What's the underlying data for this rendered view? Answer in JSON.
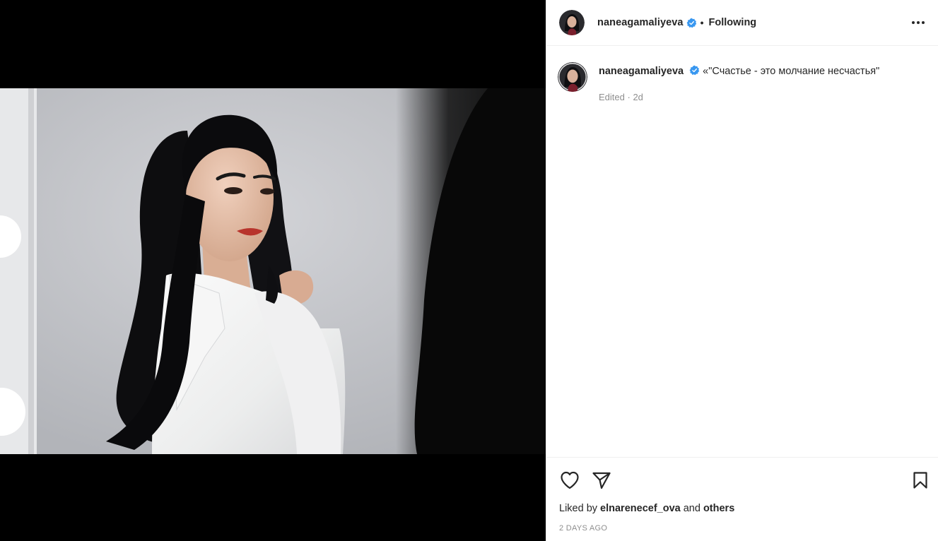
{
  "post": {
    "username": "naneagamaliyeva",
    "verified": true,
    "separator": "•",
    "follow_status": "Following",
    "more_icon": "more-horizontal-icon"
  },
  "caption": {
    "username": "naneagamaliyeva",
    "text": "«\"Счастье - это молчание несчастья\"",
    "edited_label": "Edited",
    "meta_sep": " · ",
    "age": "2d"
  },
  "actions": {
    "like_icon": "heart-icon",
    "share_icon": "paper-plane-icon",
    "save_icon": "bookmark-icon"
  },
  "likes": {
    "prefix": "Liked by ",
    "user": "elnarenecef_ova",
    "middle": " and ",
    "others": "others"
  },
  "timestamp": "2 DAYS AGO",
  "colors": {
    "verified_blue": "#3897f0",
    "text_primary": "#262626",
    "text_secondary": "#8e8e8e",
    "divider": "#efefef",
    "media_background": "#000000"
  }
}
